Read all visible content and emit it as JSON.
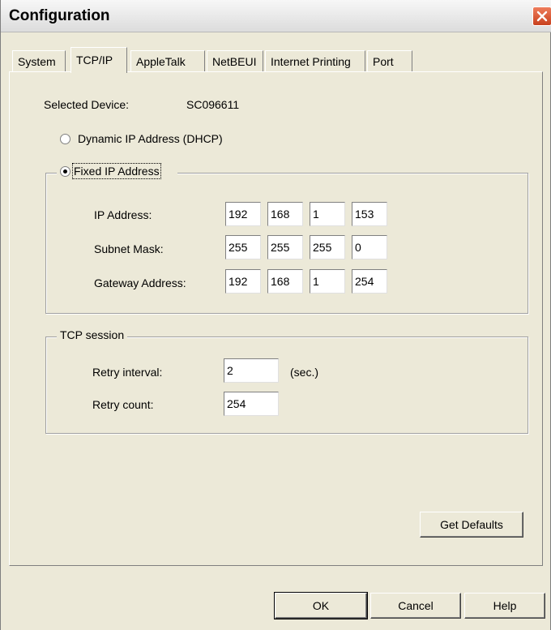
{
  "window": {
    "title": "Configuration"
  },
  "tabs": [
    {
      "label": "System",
      "active": false
    },
    {
      "label": "TCP/IP",
      "active": true
    },
    {
      "label": "AppleTalk",
      "active": false
    },
    {
      "label": "NetBEUI",
      "active": false
    },
    {
      "label": "Internet Printing",
      "active": false
    },
    {
      "label": "Port",
      "active": false
    }
  ],
  "device": {
    "label": "Selected Device:",
    "value": "SC096611"
  },
  "dhcp": {
    "label": "Dynamic IP Address (DHCP)",
    "selected": false
  },
  "fixed": {
    "label": "Fixed IP Address",
    "selected": true,
    "ip": {
      "label": "IP Address:",
      "octets": [
        "192",
        "168",
        "1",
        "153"
      ]
    },
    "subnet": {
      "label": "Subnet Mask:",
      "octets": [
        "255",
        "255",
        "255",
        "0"
      ]
    },
    "gateway": {
      "label": "Gateway Address:",
      "octets": [
        "192",
        "168",
        "1",
        "254"
      ]
    }
  },
  "tcp_session": {
    "label": "TCP session",
    "retry_interval": {
      "label": "Retry interval:",
      "value": "2",
      "unit": "(sec.)"
    },
    "retry_count": {
      "label": "Retry count:",
      "value": "254"
    }
  },
  "buttons": {
    "get_defaults": "Get Defaults",
    "ok": "OK",
    "cancel": "Cancel",
    "help": "Help"
  }
}
